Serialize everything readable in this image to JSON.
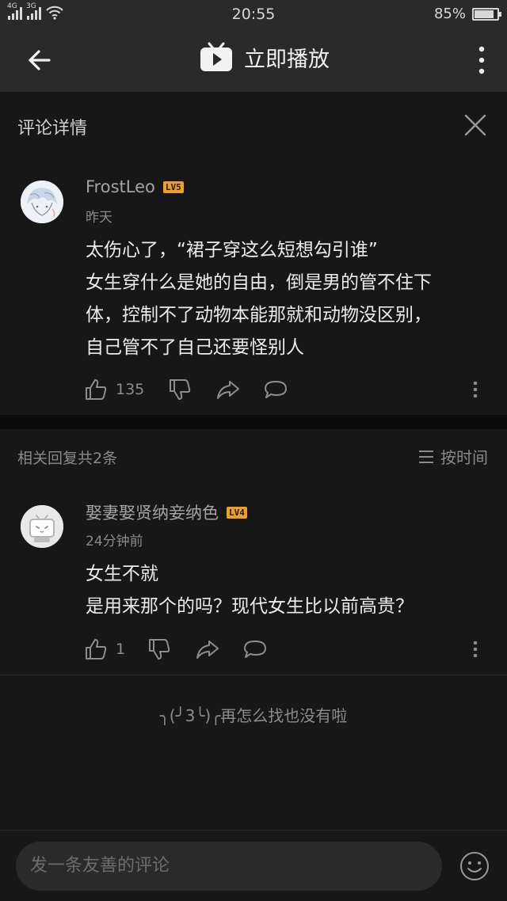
{
  "status_bar": {
    "signal_1": "4G",
    "signal_2": "3G",
    "time": "20:55",
    "battery": "85%",
    "battery_level": 0.85
  },
  "app_bar": {
    "title": "立即播放",
    "back_icon": "arrow-left-icon",
    "more_icon": "vertical-dots-icon",
    "tv_icon": "bilibili-tv-play-icon"
  },
  "detail_header": {
    "title": "评论详情",
    "close_icon": "close-x-icon"
  },
  "main_comment": {
    "username": "FrostLeo",
    "level": "LV5",
    "time": "昨天",
    "lines": [
      "太伤心了，“裙子穿这么短想勾引谁”",
      "女生穿什么是她的自由，倒是男的管不住下",
      "体，控制不了动物本能那就和动物没区别，",
      "自己管不了自己还要怪别人"
    ],
    "likes": "135"
  },
  "replies_header": {
    "count_label": "相关回复共2条",
    "sort_label": "按时间",
    "sort_icon": "list-lines-icon"
  },
  "reply": {
    "username": "娶妻娶贤纳妾纳色",
    "level": "LV4",
    "time": "24分钟前",
    "lines": [
      "女生不就",
      "是用来那个的吗？现代女生比以前高贵？"
    ],
    "likes": "1"
  },
  "end_message": "╮(╯3╰)╭再怎么找也没有啦",
  "input_bar": {
    "placeholder": "发一条友善的评论",
    "emoji_icon": "smiley-face-icon"
  }
}
